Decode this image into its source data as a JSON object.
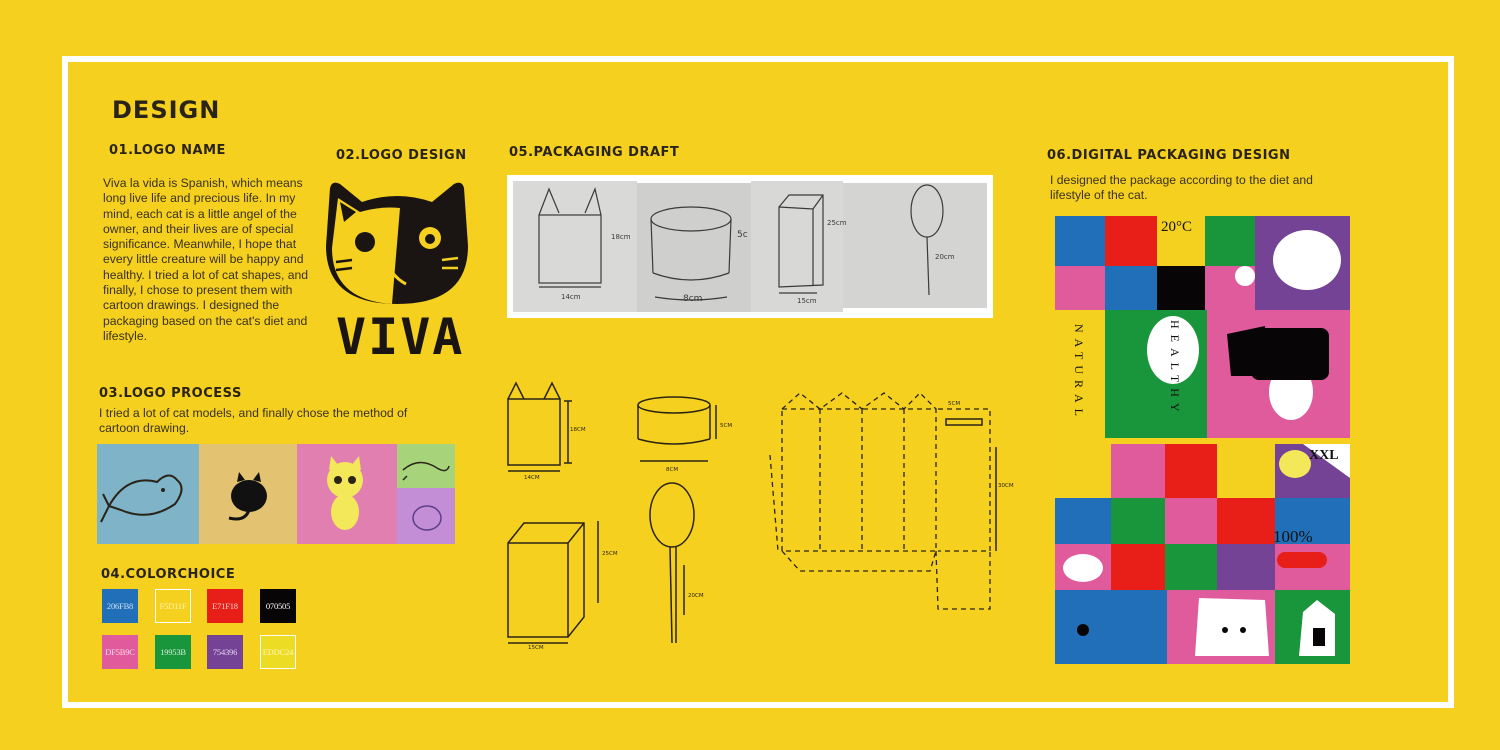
{
  "page_title": "DESIGN",
  "sections": {
    "logo_name": {
      "heading": "01.LOGO NAME",
      "body": "Viva la vida is Spanish, which means long live life and precious life. In my mind, each cat is a little angel of the owner, and their lives are of special significance. Meanwhile, I hope that every little creature will be happy and healthy. I tried a lot of cat shapes, and finally, I chose to present them with cartoon drawings. I designed the packaging based on the cat's diet and lifestyle."
    },
    "logo_design": {
      "heading": "02.LOGO DESIGN",
      "logo_text": "VIVA"
    },
    "logo_process": {
      "heading": "03.LOGO PROCESS",
      "body": "I tried a lot of cat models, and finally chose the method of cartoon drawing."
    },
    "color_choice": {
      "heading": "04.COLORCHOICE",
      "swatches": [
        {
          "label": "206FB8",
          "color": "#206fb8",
          "label_color": "#cfe0f2"
        },
        {
          "label": "F5D11F",
          "color": "#f5d11f",
          "label_color": "#fff3b0"
        },
        {
          "label": "E71F18",
          "color": "#e71f18",
          "label_color": "#ffd2cc"
        },
        {
          "label": "070505",
          "color": "#070505",
          "label_color": "#ffffff"
        },
        {
          "label": "DF5B9C",
          "color": "#df5b9c",
          "label_color": "#ffd9ea"
        },
        {
          "label": "19953B",
          "color": "#19953b",
          "label_color": "#d3f0da"
        },
        {
          "label": "754396",
          "color": "#754396",
          "label_color": "#e5d5f0"
        },
        {
          "label": "EDDC24",
          "color": "#eddc24",
          "label_color": "#fff6b8"
        }
      ]
    },
    "packaging_draft": {
      "heading": "05.PACKAGING DRAFT",
      "sketch_labels": [
        "18cm",
        "14cm",
        "8cm",
        "5c",
        "25cm",
        "15cm",
        "20cm"
      ],
      "drawing_labels": [
        "18CM",
        "14CM",
        "5CM",
        "8CM",
        "25CM",
        "15CM",
        "20CM",
        "5CM",
        "30CM"
      ]
    },
    "digital_packaging": {
      "heading": "06.DIGITAL PACKAGING DESIGN",
      "body": "I designed the package according to the diet and lifestyle of the cat.",
      "mosaic_texts": {
        "temp": "20°C",
        "natural": "NATURAL",
        "healthy": "HEALTHY",
        "size": "XXL",
        "percent": "100%"
      }
    }
  },
  "colors": {
    "background": "#f5d01e",
    "frame": "#ffffff",
    "text": "#2a2418"
  }
}
